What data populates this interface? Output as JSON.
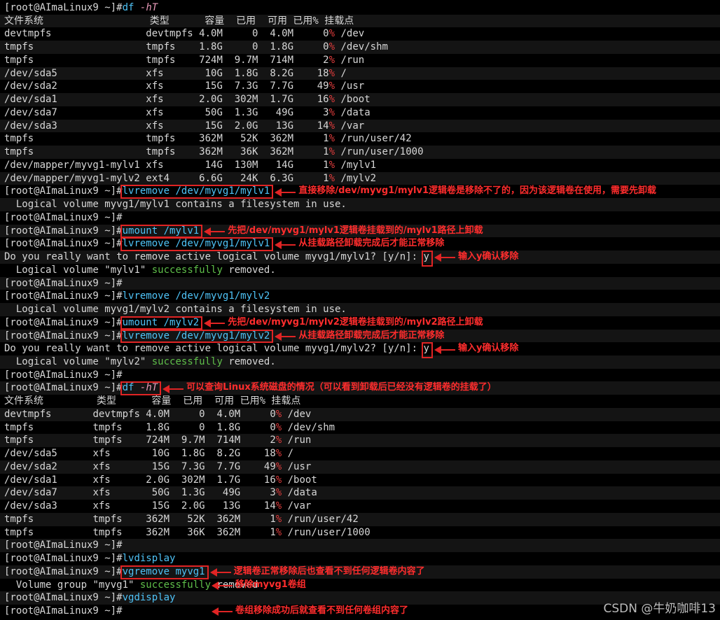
{
  "prompt": "[root@AImaLinux9 ~]",
  "lines": [
    {
      "t": "cmd",
      "cmd": "df",
      "flag": "-hT"
    },
    {
      "t": "text",
      "text": "文件系统                  类型      容量  已用  可用 已用% 挂载点"
    },
    {
      "t": "df",
      "fs": "devtmpfs",
      "type": "devtmpfs",
      "size": "4.0M",
      "used": "0",
      "avail": "4.0M",
      "pct": "0%",
      "mnt": "/dev",
      "w": 1
    },
    {
      "t": "df",
      "fs": "tmpfs",
      "type": "tmpfs",
      "size": "1.8G",
      "used": "0",
      "avail": "1.8G",
      "pct": "0%",
      "mnt": "/dev/shm",
      "w": 1
    },
    {
      "t": "df",
      "fs": "tmpfs",
      "type": "tmpfs",
      "size": "724M",
      "used": "9.7M",
      "avail": "714M",
      "pct": "2%",
      "mnt": "/run",
      "w": 1
    },
    {
      "t": "df",
      "fs": "/dev/sda5",
      "type": "xfs",
      "size": "10G",
      "used": "1.8G",
      "avail": "8.2G",
      "pct": "18%",
      "mnt": "/",
      "w": 1
    },
    {
      "t": "df",
      "fs": "/dev/sda2",
      "type": "xfs",
      "size": "15G",
      "used": "7.3G",
      "avail": "7.7G",
      "pct": "49%",
      "mnt": "/usr",
      "w": 1
    },
    {
      "t": "df",
      "fs": "/dev/sda1",
      "type": "xfs",
      "size": "2.0G",
      "used": "302M",
      "avail": "1.7G",
      "pct": "16%",
      "mnt": "/boot",
      "w": 1
    },
    {
      "t": "df",
      "fs": "/dev/sda7",
      "type": "xfs",
      "size": "50G",
      "used": "1.3G",
      "avail": "49G",
      "pct": "3%",
      "mnt": "/data",
      "w": 1
    },
    {
      "t": "df",
      "fs": "/dev/sda3",
      "type": "xfs",
      "size": "15G",
      "used": "2.0G",
      "avail": "13G",
      "pct": "14%",
      "mnt": "/var",
      "w": 1
    },
    {
      "t": "df",
      "fs": "tmpfs",
      "type": "tmpfs",
      "size": "362M",
      "used": "52K",
      "avail": "362M",
      "pct": "1%",
      "mnt": "/run/user/42",
      "w": 1
    },
    {
      "t": "df",
      "fs": "tmpfs",
      "type": "tmpfs",
      "size": "362M",
      "used": "36K",
      "avail": "362M",
      "pct": "1%",
      "mnt": "/run/user/1000",
      "w": 1
    },
    {
      "t": "df",
      "fs": "/dev/mapper/myvg1-mylv1",
      "type": "xfs",
      "size": "14G",
      "used": "130M",
      "avail": "14G",
      "pct": "1%",
      "mnt": "/mylv1",
      "w": 1
    },
    {
      "t": "df",
      "fs": "/dev/mapper/myvg1-mylv2",
      "type": "ext4",
      "size": "6.6G",
      "used": "24K",
      "avail": "6.3G",
      "pct": "1%",
      "mnt": "/mylv2",
      "w": 1
    },
    {
      "t": "cmd",
      "cmd": "lvremove",
      "arg": "/dev/myvg1/mylv1"
    },
    {
      "t": "text",
      "text": "  Logical volume myvg1/mylv1 contains a filesystem in use."
    },
    {
      "t": "cmd"
    },
    {
      "t": "cmd",
      "cmd": "umount",
      "arg": "/mylv1"
    },
    {
      "t": "cmd",
      "cmd": "lvremove",
      "arg": "/dev/myvg1/mylv1"
    },
    {
      "t": "confirm",
      "text": "Do you really want to remove active logical volume myvg1/mylv1? [y/n]: ",
      "ans": "y"
    },
    {
      "t": "removed",
      "pre": "  Logical volume ",
      "name": "\"mylv1\"",
      "ok": " successfully",
      "post": " removed."
    },
    {
      "t": "cmd"
    },
    {
      "t": "cmd",
      "cmd": "lvremove",
      "arg": "/dev/myvg1/mylv2"
    },
    {
      "t": "text",
      "text": "  Logical volume myvg1/mylv2 contains a filesystem in use."
    },
    {
      "t": "cmd",
      "cmd": "umount",
      "arg": "/mylv2"
    },
    {
      "t": "cmd",
      "cmd": "lvremove",
      "arg": "/dev/myvg1/mylv2"
    },
    {
      "t": "confirm",
      "text": "Do you really want to remove active logical volume myvg1/mylv2? [y/n]: ",
      "ans": "y"
    },
    {
      "t": "removed",
      "pre": "  Logical volume ",
      "name": "\"mylv2\"",
      "ok": " successfully",
      "post": " removed."
    },
    {
      "t": "cmd"
    },
    {
      "t": "cmd",
      "cmd": "df",
      "flag": "-hT"
    },
    {
      "t": "text",
      "text": "文件系统         类型      容量  已用  可用 已用% 挂载点"
    },
    {
      "t": "df",
      "fs": "devtmpfs",
      "type": "devtmpfs",
      "size": "4.0M",
      "used": "0",
      "avail": "4.0M",
      "pct": "0%",
      "mnt": "/dev",
      "w": 0
    },
    {
      "t": "df",
      "fs": "tmpfs",
      "type": "tmpfs",
      "size": "1.8G",
      "used": "0",
      "avail": "1.8G",
      "pct": "0%",
      "mnt": "/dev/shm",
      "w": 0
    },
    {
      "t": "df",
      "fs": "tmpfs",
      "type": "tmpfs",
      "size": "724M",
      "used": "9.7M",
      "avail": "714M",
      "pct": "2%",
      "mnt": "/run",
      "w": 0
    },
    {
      "t": "df",
      "fs": "/dev/sda5",
      "type": "xfs",
      "size": "10G",
      "used": "1.8G",
      "avail": "8.2G",
      "pct": "18%",
      "mnt": "/",
      "w": 0
    },
    {
      "t": "df",
      "fs": "/dev/sda2",
      "type": "xfs",
      "size": "15G",
      "used": "7.3G",
      "avail": "7.7G",
      "pct": "49%",
      "mnt": "/usr",
      "w": 0
    },
    {
      "t": "df",
      "fs": "/dev/sda1",
      "type": "xfs",
      "size": "2.0G",
      "used": "302M",
      "avail": "1.7G",
      "pct": "16%",
      "mnt": "/boot",
      "w": 0
    },
    {
      "t": "df",
      "fs": "/dev/sda7",
      "type": "xfs",
      "size": "50G",
      "used": "1.3G",
      "avail": "49G",
      "pct": "3%",
      "mnt": "/data",
      "w": 0
    },
    {
      "t": "df",
      "fs": "/dev/sda3",
      "type": "xfs",
      "size": "15G",
      "used": "2.0G",
      "avail": "13G",
      "pct": "14%",
      "mnt": "/var",
      "w": 0
    },
    {
      "t": "df",
      "fs": "tmpfs",
      "type": "tmpfs",
      "size": "362M",
      "used": "52K",
      "avail": "362M",
      "pct": "1%",
      "mnt": "/run/user/42",
      "w": 0
    },
    {
      "t": "df",
      "fs": "tmpfs",
      "type": "tmpfs",
      "size": "362M",
      "used": "36K",
      "avail": "362M",
      "pct": "1%",
      "mnt": "/run/user/1000",
      "w": 0
    },
    {
      "t": "cmd"
    },
    {
      "t": "cmd",
      "cmd": "lvdisplay"
    },
    {
      "t": "cmd",
      "cmd": "vgremove",
      "arg": "myvg1"
    },
    {
      "t": "removed",
      "pre": "  Volume group ",
      "name": "\"myvg1\"",
      "ok": " successfully",
      "post": " removed"
    },
    {
      "t": "cmd",
      "cmd": "vgdisplay"
    },
    {
      "t": "cmd"
    }
  ],
  "annotations": [
    {
      "line": 14,
      "text": "直接移除/dev/myvg1/mylv1逻辑卷是移除不了的，因为该逻辑卷在使用，需要先卸载"
    },
    {
      "line": 17,
      "text": "先把/dev/myvg1/mylv1逻辑卷挂载到的/mylv1路径上卸载"
    },
    {
      "line": 18,
      "text": "从挂载路径卸载完成后才能正常移除"
    },
    {
      "line": 19,
      "text": "输入y确认移除"
    },
    {
      "line": 24,
      "text": "先把/dev/myvg1/mylv2逻辑卷挂载到的/mylv2路径上卸载"
    },
    {
      "line": 25,
      "text": "从挂载路径卸载完成后才能正常移除"
    },
    {
      "line": 26,
      "text": "输入y确认移除"
    },
    {
      "line": 29,
      "text": "可以查询Linux系统磁盘的情况（可以看到卸载后已经没有逻辑卷的挂载了）"
    },
    {
      "line": 43,
      "text": "逻辑卷正常移除后也查看不到任何逻辑卷内容了"
    },
    {
      "line": 44,
      "text": "移除myvg1卷组"
    },
    {
      "line": 46,
      "text": "卷组移除成功后就查看不到任何卷组内容了"
    }
  ],
  "watermark": "CSDN @牛奶咖啡13"
}
